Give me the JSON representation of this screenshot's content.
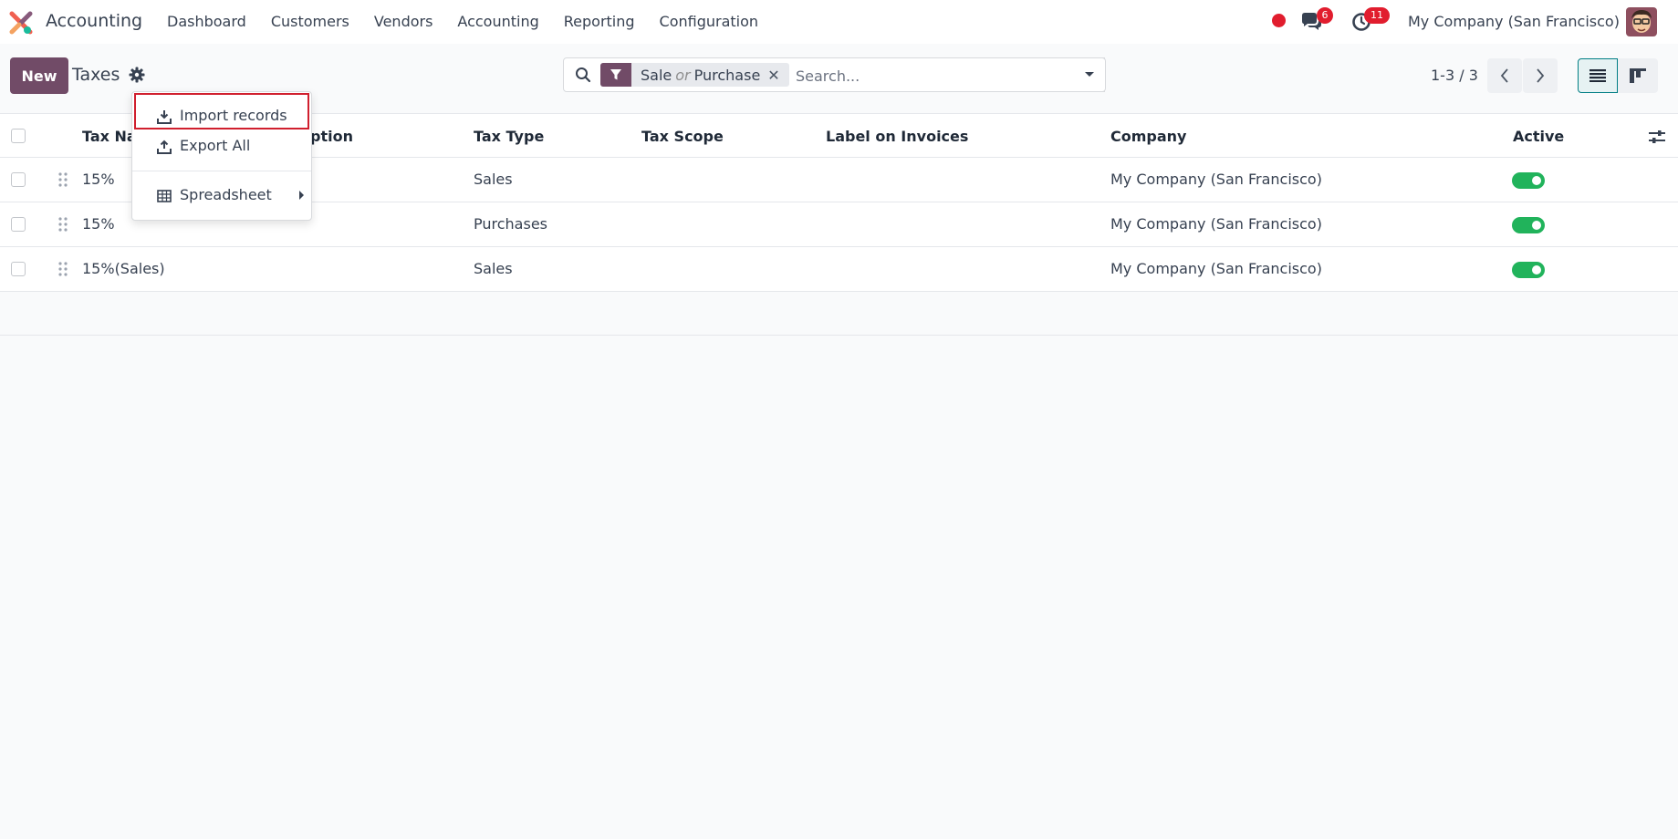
{
  "navbar": {
    "app_name": "Accounting",
    "menu": [
      "Dashboard",
      "Customers",
      "Vendors",
      "Accounting",
      "Reporting",
      "Configuration"
    ],
    "messages_count": "6",
    "activities_count": "11",
    "company": "My Company (San Francisco)"
  },
  "control_panel": {
    "new_label": "New",
    "title": "Taxes",
    "search": {
      "facet_values": [
        "Sale",
        "Purchase"
      ],
      "facet_or": "or",
      "placeholder": "Search..."
    },
    "pager": "1-3 / 3"
  },
  "dropdown": {
    "items": [
      "Import records",
      "Export All",
      "Spreadsheet"
    ]
  },
  "table": {
    "headers": {
      "tax_name": "Tax Na",
      "description": "ption",
      "tax_type": "Tax Type",
      "tax_scope": "Tax Scope",
      "label_on_invoices": "Label on Invoices",
      "company": "Company",
      "active": "Active"
    },
    "rows": [
      {
        "tax_name": "15%",
        "tax_type": "Sales",
        "company": "My Company (San Francisco)",
        "active": true
      },
      {
        "tax_name": "15%",
        "tax_type": "Purchases",
        "company": "My Company (San Francisco)",
        "active": true
      },
      {
        "tax_name": "15%(Sales)",
        "tax_type": "Sales",
        "company": "My Company (San Francisco)",
        "active": true
      }
    ]
  },
  "colors": {
    "brand": "#714B67",
    "active_toggle": "#21b35b",
    "badge": "#e11d2e",
    "highlight": "#d01f2e"
  }
}
